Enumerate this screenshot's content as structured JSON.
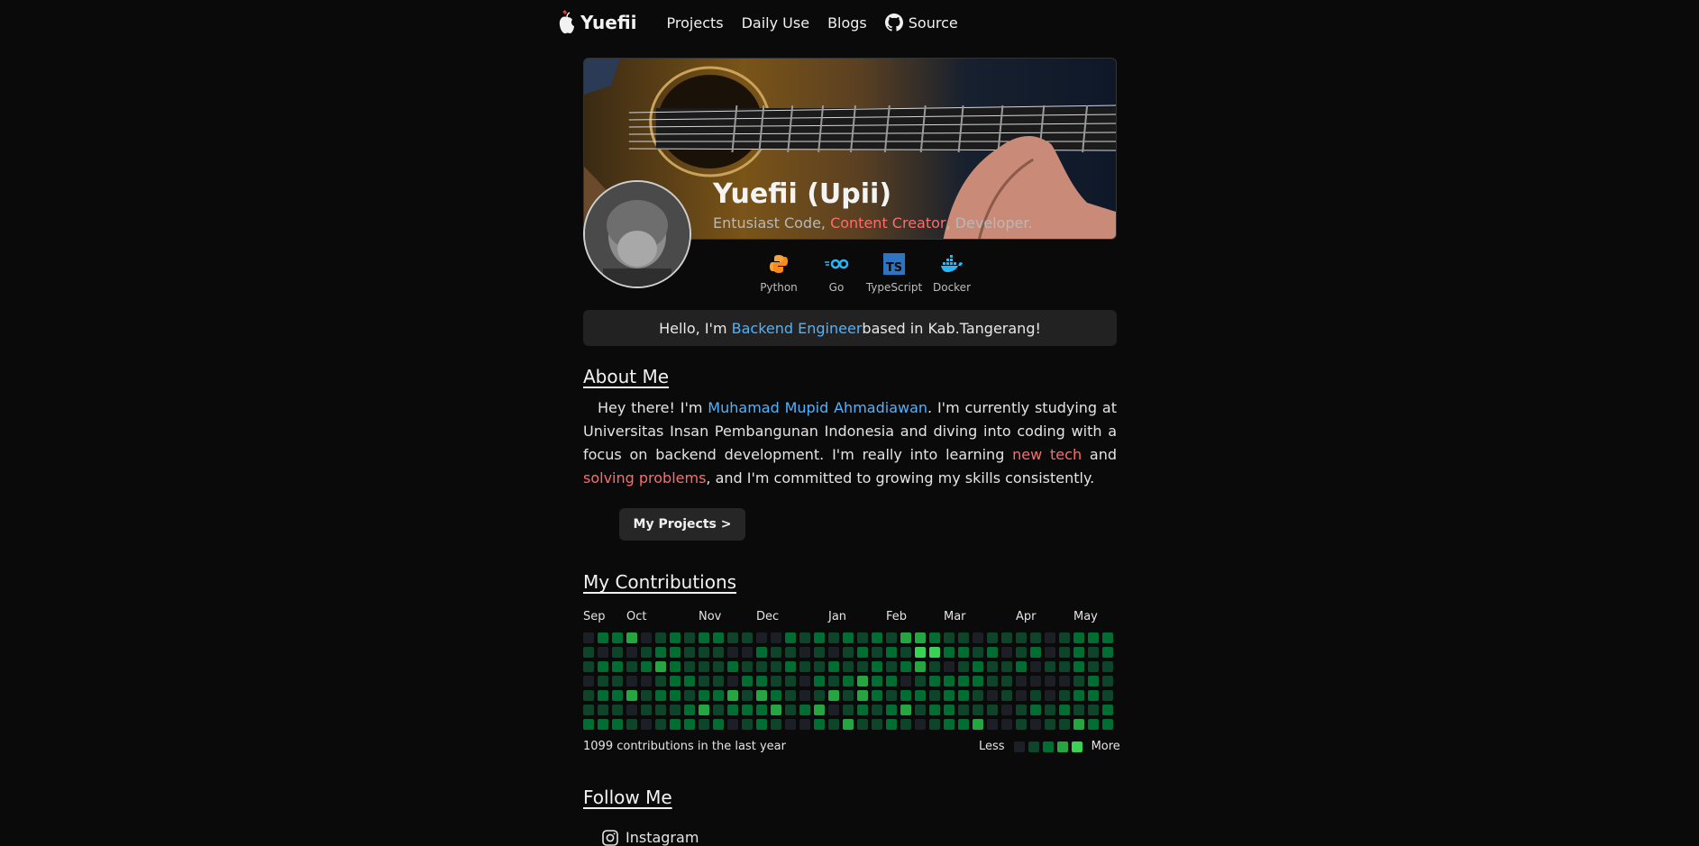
{
  "nav": {
    "brand": "Yuefii",
    "links": [
      "Projects",
      "Daily Use",
      "Blogs"
    ],
    "source": "Source",
    "icons": {
      "brand": "apple-heart-logo",
      "source": "github-icon"
    }
  },
  "profile": {
    "name": "Yuefii (Upii)",
    "tagline_before": "Entusiast Code, ",
    "tagline_highlight": "Content Creator",
    "tagline_after": ", Developer.",
    "skills": [
      {
        "label": "Python",
        "icon": "python-icon"
      },
      {
        "label": "Go",
        "icon": "go-icon"
      },
      {
        "label": "TypeScript",
        "icon": "typescript-icon"
      },
      {
        "label": "Docker",
        "icon": "docker-icon"
      }
    ]
  },
  "hello": {
    "before": "Hello, I'm ",
    "role": "Backend Engineer",
    "after": " based in Kab.Tangerang!"
  },
  "about": {
    "title": "About Me",
    "p1": "Hey there! I'm ",
    "name": "Muhamad Mupid Ahmadiawan",
    "p2": ". I'm currently studying at Universitas Insan Pembangunan Indonesia and diving into coding with a focus on backend development. I'm really into learning ",
    "hl1": "new tech",
    "p3": " and ",
    "hl2": "solving problems",
    "p4": ", and I'm committed to growing my skills consistently.",
    "button": "My Projects >"
  },
  "contributions": {
    "title": "My Contributions",
    "months": [
      "Sep",
      "Oct",
      "Nov",
      "Dec",
      "Jan",
      "Feb",
      "Mar",
      "Apr",
      "May"
    ],
    "total_text": "1099 contributions in the last year",
    "legend_less": "Less",
    "legend_more": "More",
    "colors": [
      "#1c2026",
      "#0e4429",
      "#006d32",
      "#26a641",
      "#39d353"
    ],
    "weeks": [
      [
        0,
        1,
        1,
        0,
        1,
        1,
        2
      ],
      [
        2,
        0,
        2,
        1,
        2,
        1,
        2
      ],
      [
        2,
        1,
        2,
        1,
        2,
        1,
        2
      ],
      [
        3,
        0,
        1,
        0,
        3,
        0,
        1
      ],
      [
        0,
        1,
        2,
        0,
        1,
        1,
        0
      ],
      [
        1,
        2,
        3,
        1,
        2,
        1,
        1
      ],
      [
        2,
        2,
        2,
        2,
        2,
        1,
        2
      ],
      [
        1,
        1,
        1,
        2,
        1,
        2,
        2
      ],
      [
        2,
        1,
        1,
        1,
        2,
        3,
        1
      ],
      [
        2,
        1,
        1,
        1,
        2,
        1,
        2
      ],
      [
        1,
        0,
        2,
        0,
        3,
        2,
        0
      ],
      [
        1,
        0,
        1,
        2,
        1,
        2,
        1
      ],
      [
        0,
        2,
        1,
        2,
        3,
        2,
        2
      ],
      [
        0,
        1,
        1,
        1,
        2,
        3,
        1
      ],
      [
        2,
        1,
        2,
        1,
        1,
        1,
        0
      ],
      [
        1,
        0,
        1,
        0,
        0,
        2,
        0
      ],
      [
        2,
        1,
        1,
        2,
        1,
        3,
        2
      ],
      [
        1,
        0,
        2,
        1,
        3,
        0,
        1
      ],
      [
        2,
        1,
        1,
        2,
        1,
        1,
        3
      ],
      [
        1,
        2,
        1,
        3,
        3,
        2,
        1
      ],
      [
        2,
        1,
        2,
        2,
        2,
        1,
        1
      ],
      [
        1,
        2,
        1,
        2,
        1,
        2,
        2
      ],
      [
        3,
        1,
        2,
        0,
        2,
        3,
        1
      ],
      [
        3,
        4,
        3,
        1,
        2,
        1,
        0
      ],
      [
        2,
        4,
        1,
        2,
        1,
        2,
        1
      ],
      [
        1,
        2,
        0,
        2,
        2,
        2,
        2
      ],
      [
        1,
        2,
        1,
        2,
        2,
        1,
        2
      ],
      [
        0,
        1,
        2,
        2,
        1,
        1,
        3
      ],
      [
        1,
        2,
        1,
        1,
        0,
        1,
        0
      ],
      [
        1,
        0,
        1,
        1,
        1,
        0,
        0
      ],
      [
        1,
        1,
        2,
        0,
        0,
        1,
        1
      ],
      [
        1,
        2,
        0,
        0,
        1,
        2,
        0
      ],
      [
        0,
        0,
        1,
        0,
        0,
        1,
        1
      ],
      [
        1,
        1,
        1,
        0,
        1,
        2,
        1
      ],
      [
        2,
        2,
        2,
        1,
        2,
        1,
        3
      ],
      [
        2,
        1,
        1,
        2,
        2,
        1,
        2
      ],
      [
        2,
        2,
        1,
        1,
        1,
        2,
        2
      ]
    ]
  },
  "follow": {
    "title": "Follow Me",
    "items": [
      {
        "label": "Instagram",
        "icon": "instagram-icon"
      }
    ]
  }
}
